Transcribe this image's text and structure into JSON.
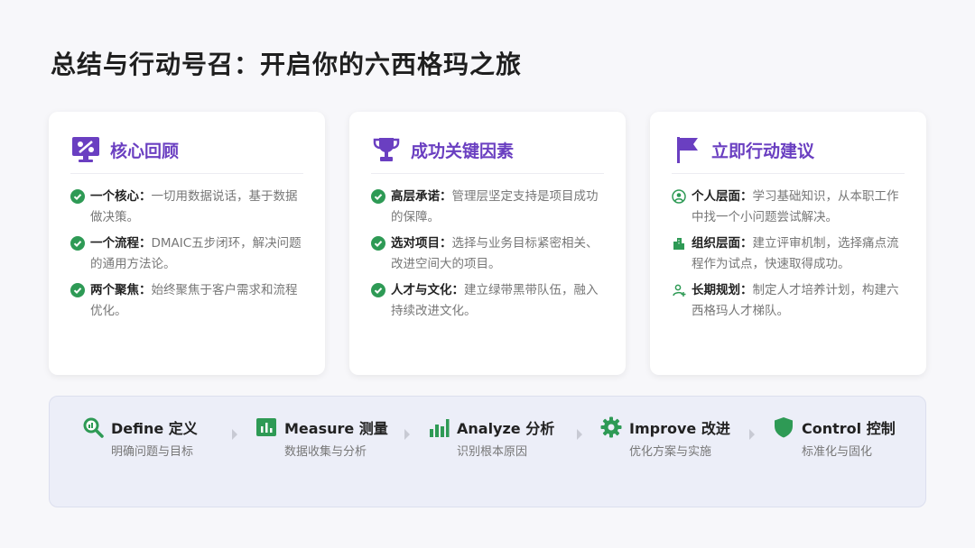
{
  "title": "总结与行动号召：开启你的六西格玛之旅",
  "colors": {
    "accent": "#6a3fc1",
    "green": "#2e9a55"
  },
  "cards": [
    {
      "icon": "dashboard-icon",
      "title": "核心回顾",
      "items": [
        {
          "icon": "check-circle-icon",
          "bold": "一个核心：",
          "text": "一切用数据说话，基于数据做决策。"
        },
        {
          "icon": "check-circle-icon",
          "bold": "一个流程：",
          "text": "DMAIC五步闭环，解决问题的通用方法论。"
        },
        {
          "icon": "check-circle-icon",
          "bold": "两个聚焦：",
          "text": "始终聚焦于客户需求和流程优化。"
        }
      ]
    },
    {
      "icon": "trophy-icon",
      "title": "成功关键因素",
      "items": [
        {
          "icon": "check-circle-icon",
          "bold": "高层承诺：",
          "text": "管理层坚定支持是项目成功的保障。"
        },
        {
          "icon": "check-circle-icon",
          "bold": "选对项目：",
          "text": "选择与业务目标紧密相关、改进空间大的项目。"
        },
        {
          "icon": "check-circle-icon",
          "bold": "人才与文化：",
          "text": "建立绿带黑带队伍，融入持续改进文化。"
        }
      ]
    },
    {
      "icon": "flag-icon",
      "title": "立即行动建议",
      "items": [
        {
          "icon": "user-circle-icon",
          "bold": "个人层面：",
          "text": "学习基础知识，从本职工作中找一个小问题尝试解决。"
        },
        {
          "icon": "building-icon",
          "bold": "组织层面：",
          "text": "建立评审机制，选择痛点流程作为试点，快速取得成功。"
        },
        {
          "icon": "user-plus-icon",
          "bold": "长期规划：",
          "text": "制定人才培养计划，构建六西格玛人才梯队。"
        }
      ]
    }
  ],
  "steps": [
    {
      "icon": "search-chart-icon",
      "name": "Define 定义",
      "desc": "明确问题与目标"
    },
    {
      "icon": "bar-chart-icon",
      "name": "Measure 测量",
      "desc": "数据收集与分析"
    },
    {
      "icon": "column-chart-icon",
      "name": "Analyze 分析",
      "desc": "识别根本原因"
    },
    {
      "icon": "gear-icon",
      "name": "Improve 改进",
      "desc": "优化方案与实施"
    },
    {
      "icon": "shield-icon",
      "name": "Control 控制",
      "desc": "标准化与固化"
    }
  ]
}
